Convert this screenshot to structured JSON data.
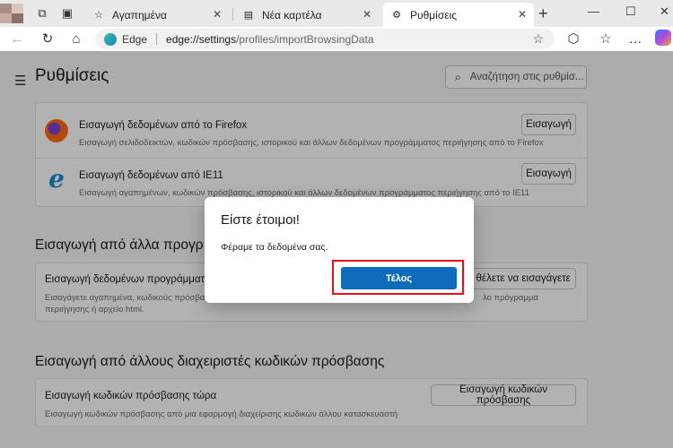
{
  "tabs": [
    {
      "label": "Αγαπημένα",
      "icon": "star-list-icon"
    },
    {
      "label": "Νέα καρτέλα",
      "icon": "new-tab-page-icon"
    },
    {
      "label": "Ρυθμίσεις",
      "icon": "gear-icon",
      "active": true
    }
  ],
  "address": {
    "edge_label": "Edge",
    "url_host": "edge://settings",
    "url_path": "/profiles/importBrowsingData"
  },
  "settings": {
    "title": "Ρυθμίσεις",
    "search_placeholder": "Αναζήτηση στις ρυθμίσ..."
  },
  "browsers": [
    {
      "title": "Εισαγωγή δεδομένων από το Firefox",
      "desc": "Εισαγωγή σελιδοδεικτών, κωδικών πρόσβασης, ιστορικού και άλλων δεδομένων προγράμματος περιήγησης από το Firefox",
      "button": "Εισαγωγή"
    },
    {
      "title": "Εισαγωγή δεδομένων από IE11",
      "desc": "Εισαγωγή αγαπημένων, κωδικών πρόσβασης, ιστορικού και άλλων δεδομένων προγράμματος περιήγησης από το IE11",
      "button": "Εισαγωγή"
    }
  ],
  "other_section": {
    "heading": "Εισαγωγή από άλλα προγρ",
    "row_title": "Εισαγωγή δεδομένων προγράμματο",
    "row_desc_1": "Εισαγάγετε αγαπημένα, κωδικούς πρόσβασ",
    "row_desc_1b": "λο πρόγραμμα",
    "row_desc_2": "περιήγησης ή αρχείο html.",
    "button": "ε θέλετε να εισαγάγετε"
  },
  "password_section": {
    "heading": "Εισαγωγή από άλλους διαχειριστές κωδικών πρόσβασης",
    "row_title": "Εισαγωγή κωδικών πρόσβασης τώρα",
    "row_desc": "Εισαγωγή κωδικών πρόσβασης από μια εφαρμογή διαχείρισης κωδικών άλλου κατασκευαστή",
    "button": "Εισαγωγή κωδικών πρόσβασης"
  },
  "dialog": {
    "title": "Είστε έτοιμοι!",
    "message": "Φέραμε τα δεδομένα σας.",
    "done_label": "Τέλος"
  },
  "colors": {
    "accent": "#0f6cbd",
    "highlight": "#e0121e"
  }
}
